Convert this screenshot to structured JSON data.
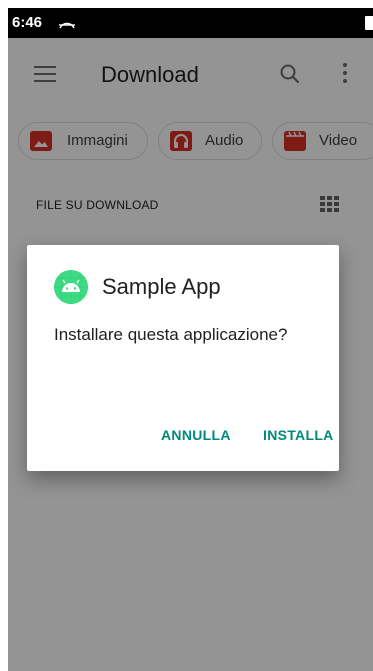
{
  "status_bar": {
    "time": "6:46",
    "cast_icon": "cast-icon",
    "battery_icon": "battery-icon"
  },
  "app_bar": {
    "menu_icon": "menu-icon",
    "title": "Download",
    "search_icon": "search-icon",
    "more_icon": "more-vert-icon"
  },
  "chips": [
    {
      "label": "Immagini",
      "icon": "image-icon"
    },
    {
      "label": "Audio",
      "icon": "headphones-icon"
    },
    {
      "label": "Video",
      "icon": "movie-icon"
    }
  ],
  "section": {
    "header": "FILE SU DOWNLOAD",
    "view_toggle_icon": "grid-view-icon"
  },
  "dialog": {
    "app_icon": "android-icon",
    "title": "Sample App",
    "message": "Installare questa applicazione?",
    "cancel_label": "ANNULLA",
    "install_label": "INSTALLA"
  },
  "colors": {
    "accent": "#00897b",
    "chip_icon": "#d93025",
    "android_green": "#3ddc84",
    "scrim": "rgba(0,0,0,0.42)"
  }
}
